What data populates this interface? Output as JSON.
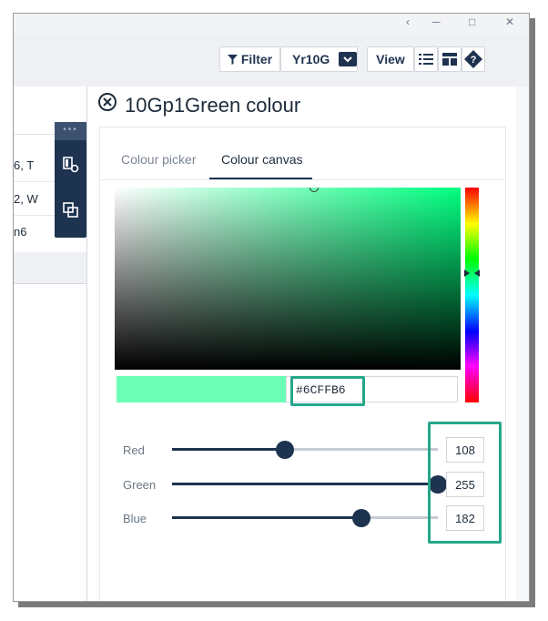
{
  "toolbar": {
    "filter_label": "Filter",
    "year_value": "Yr10G",
    "view_label": "View"
  },
  "left_rows": [
    "6, T",
    "2, W",
    "n6"
  ],
  "panel": {
    "title": "10Gp1Green colour",
    "tabs": [
      {
        "label": "Colour picker",
        "active": false
      },
      {
        "label": "Colour canvas",
        "active": true
      }
    ],
    "hex_value": "#6CFFB6",
    "selected_color": "#6CFFB6",
    "sliders": [
      {
        "label": "Red",
        "value": "108",
        "fraction": 0.424
      },
      {
        "label": "Green",
        "value": "255",
        "fraction": 1.0
      },
      {
        "label": "Blue",
        "value": "182",
        "fraction": 0.714
      }
    ]
  },
  "colors": {
    "navy": "#1d3350",
    "highlight": "#27a68a",
    "hue_color": "#00ff80"
  },
  "icons": [
    "filter-icon",
    "chevron-down-icon",
    "list-view-icon",
    "layout-icon",
    "help-icon",
    "close-circle-icon",
    "format-painter-icon",
    "copy-layers-icon"
  ]
}
